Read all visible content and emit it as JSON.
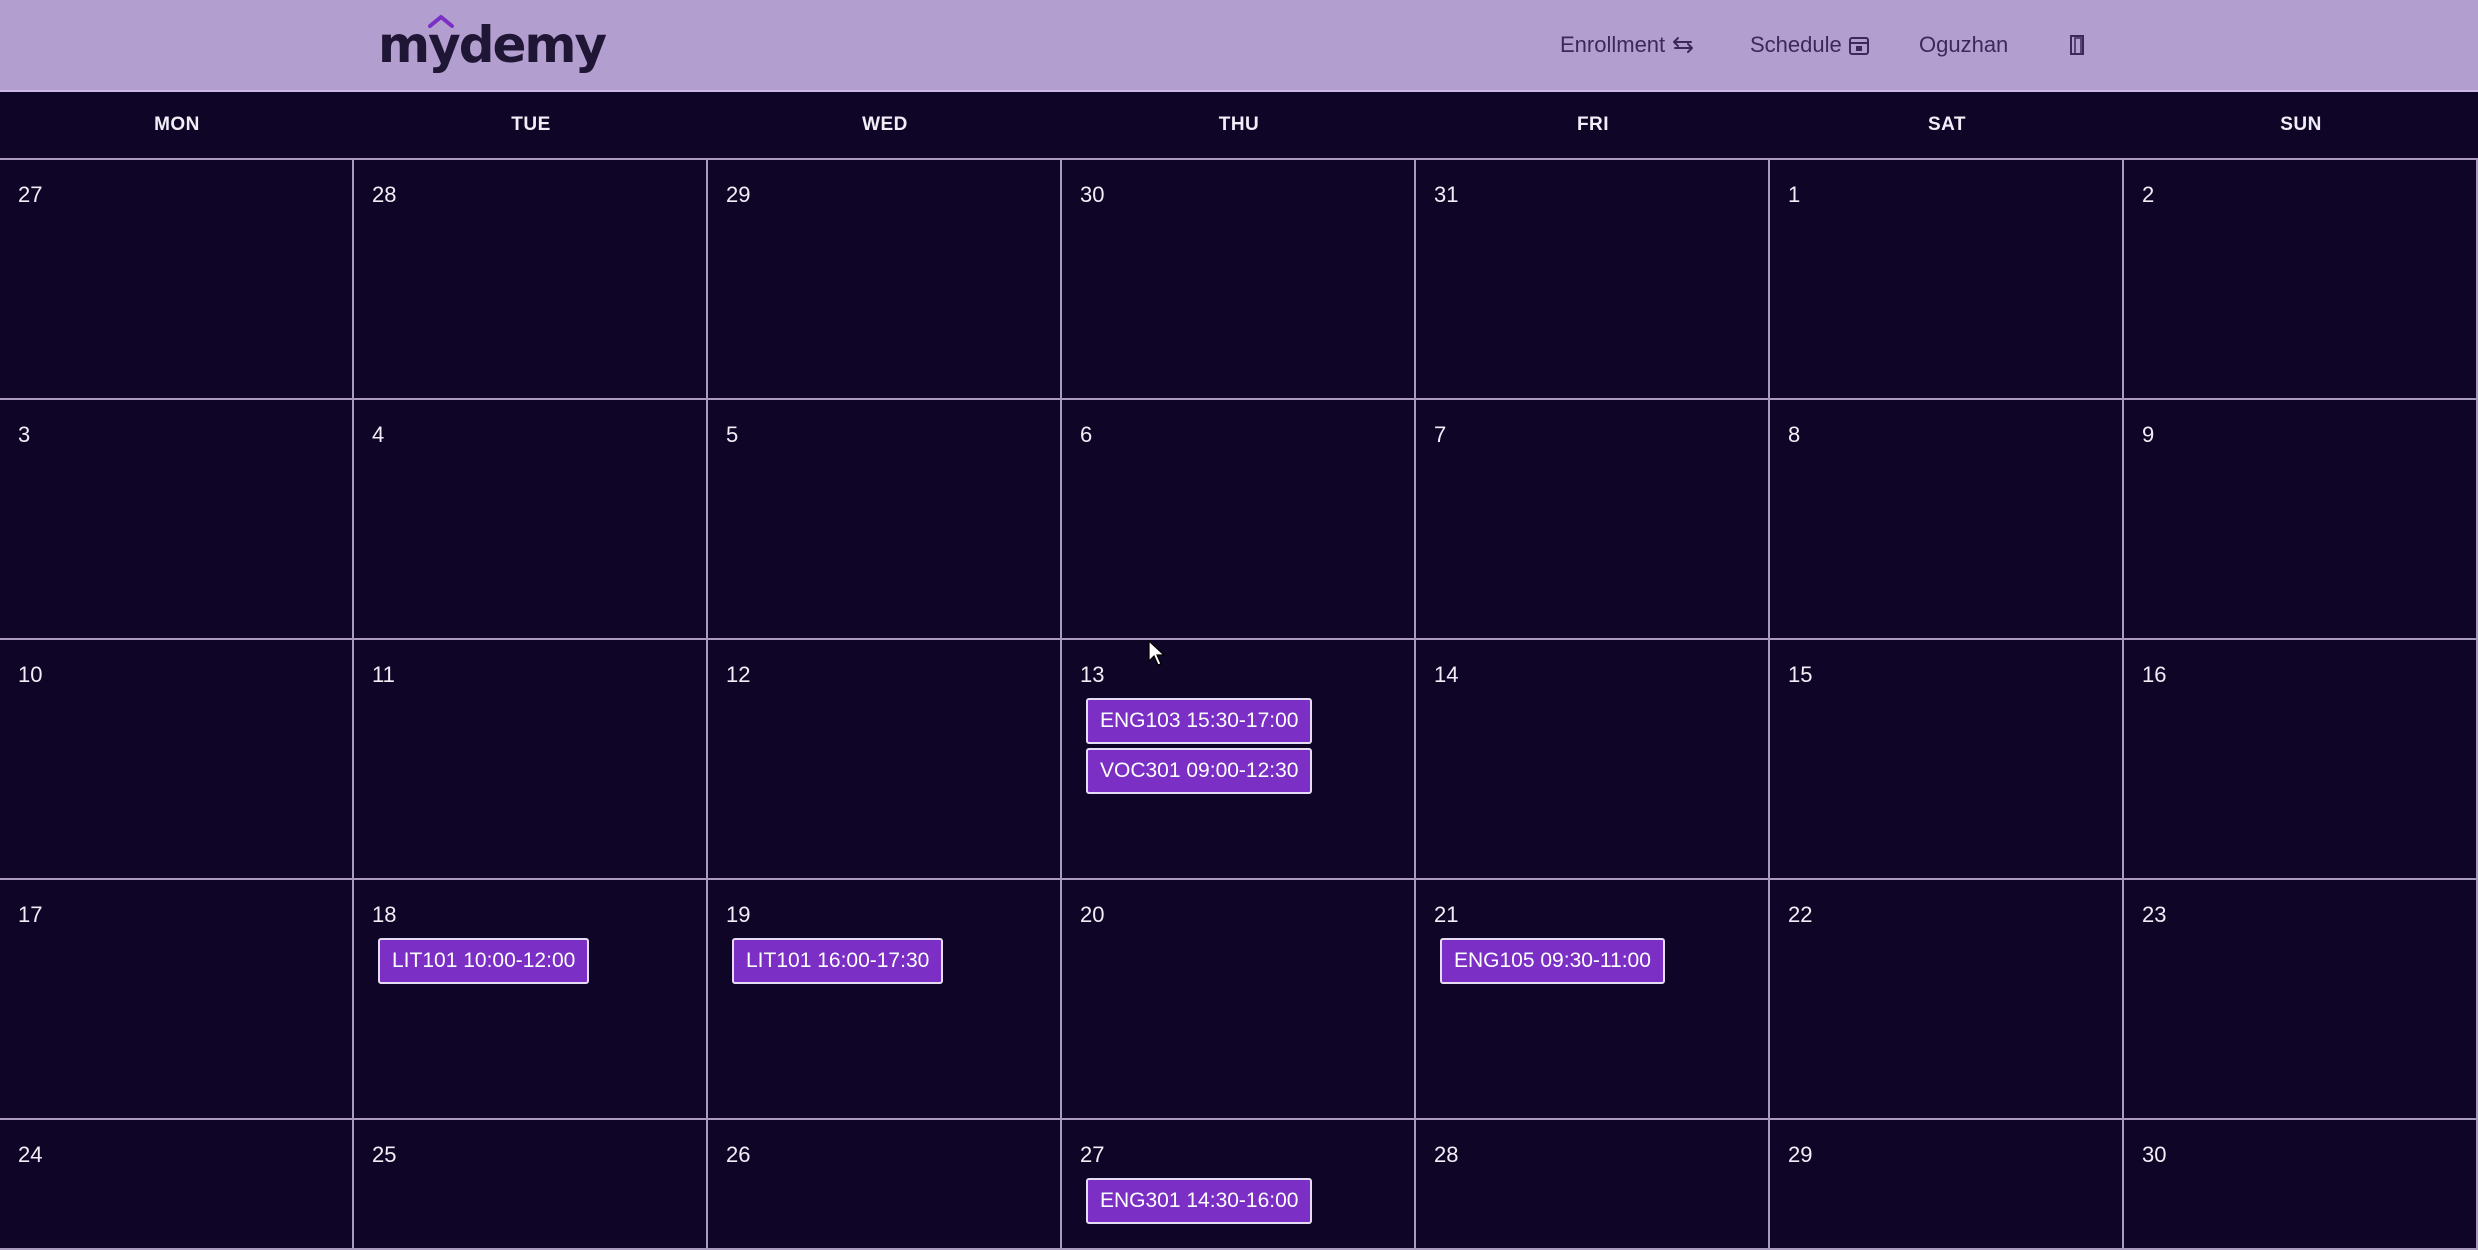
{
  "brand": {
    "logo_text": "mydemy"
  },
  "nav": {
    "enrollment_label": "Enrollment",
    "enrollment_icon": "swap-arrows-icon",
    "schedule_label": "Schedule",
    "schedule_icon": "calendar-icon",
    "user_name": "Oguzhan",
    "logout_icon": "door-exit-icon"
  },
  "colors": {
    "navbar_bg": "#b39ed0",
    "page_bg": "#0f0627",
    "event_bg": "#7b2fc4",
    "grid_line": "#a99bbd"
  },
  "calendar": {
    "weekdays": [
      "MON",
      "TUE",
      "WED",
      "THU",
      "FRI",
      "SAT",
      "SUN"
    ],
    "weeks": [
      [
        {
          "day": "27"
        },
        {
          "day": "28"
        },
        {
          "day": "29"
        },
        {
          "day": "30"
        },
        {
          "day": "31"
        },
        {
          "day": "1"
        },
        {
          "day": "2"
        }
      ],
      [
        {
          "day": "3"
        },
        {
          "day": "4"
        },
        {
          "day": "5"
        },
        {
          "day": "6"
        },
        {
          "day": "7"
        },
        {
          "day": "8"
        },
        {
          "day": "9"
        }
      ],
      [
        {
          "day": "10"
        },
        {
          "day": "11"
        },
        {
          "day": "12"
        },
        {
          "day": "13",
          "events": [
            "ENG103 15:30-17:00",
            "VOC301 09:00-12:30"
          ]
        },
        {
          "day": "14"
        },
        {
          "day": "15"
        },
        {
          "day": "16"
        }
      ],
      [
        {
          "day": "17"
        },
        {
          "day": "18",
          "events": [
            "LIT101 10:00-12:00"
          ]
        },
        {
          "day": "19",
          "events": [
            "LIT101 16:00-17:30"
          ]
        },
        {
          "day": "20"
        },
        {
          "day": "21",
          "events": [
            "ENG105 09:30-11:00"
          ]
        },
        {
          "day": "22"
        },
        {
          "day": "23"
        }
      ],
      [
        {
          "day": "24"
        },
        {
          "day": "25"
        },
        {
          "day": "26"
        },
        {
          "day": "27",
          "events": [
            "ENG301 14:30-16:00"
          ]
        },
        {
          "day": "28"
        },
        {
          "day": "29"
        },
        {
          "day": "30"
        }
      ]
    ]
  }
}
